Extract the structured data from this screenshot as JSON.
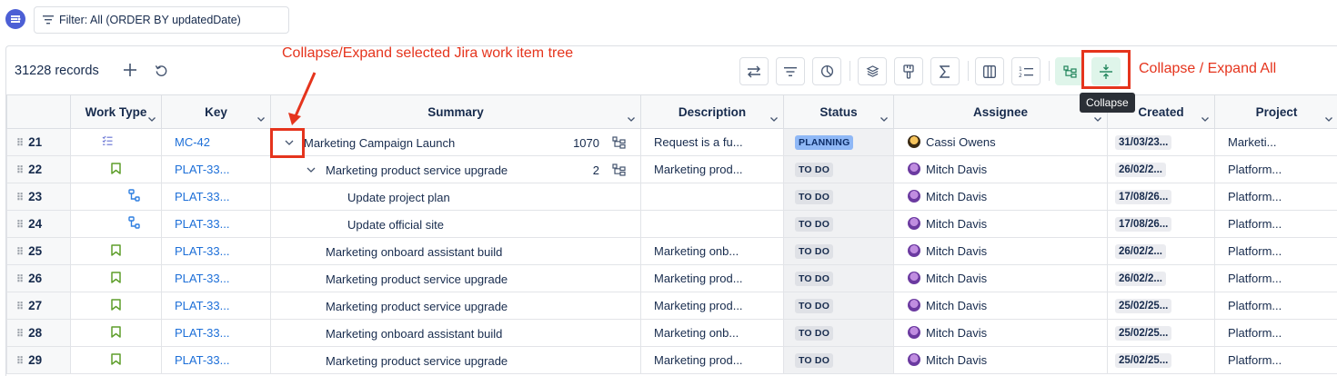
{
  "filter": {
    "label": "Filter: All (ORDER BY updatedDate)"
  },
  "toolbar": {
    "records": "31228 records",
    "tooltip": "Collapse"
  },
  "annotations": {
    "tree_label": "Collapse/Expand selected Jira work item tree",
    "expand_all_label": "Collapse / Expand All"
  },
  "columns": [
    "Work Type",
    "Key",
    "Summary",
    "Description",
    "Status",
    "Assignee",
    "Created",
    "Project"
  ],
  "rows": [
    {
      "num": "21",
      "type": "epic-icon",
      "key": "MC-42",
      "summary": "Marketing Campaign Launch",
      "depth": 0,
      "chevron": true,
      "count": "1070",
      "description": "Request is a fu...",
      "status": "PLANNING",
      "status_kind": "planning",
      "assignee": "Cassi Owens",
      "avatar": "cassi",
      "created": "31/03/23...",
      "project": "Marketi..."
    },
    {
      "num": "22",
      "type": "story-icon",
      "key": "PLAT-33...",
      "summary": "Marketing product service upgrade",
      "depth": 1,
      "chevron": true,
      "count": "2",
      "description": "Marketing prod...",
      "status": "TO DO",
      "status_kind": "todo",
      "assignee": "Mitch Davis",
      "avatar": "mitch",
      "created": "26/02/2...",
      "project": "Platform..."
    },
    {
      "num": "23",
      "type": "subtask-icon",
      "key": "PLAT-33...",
      "summary": "Update project plan",
      "depth": 2,
      "chevron": false,
      "count": "",
      "description": "",
      "status": "TO DO",
      "status_kind": "todo",
      "assignee": "Mitch Davis",
      "avatar": "mitch",
      "created": "17/08/26...",
      "project": "Platform..."
    },
    {
      "num": "24",
      "type": "subtask-icon",
      "key": "PLAT-33...",
      "summary": "Update official site",
      "depth": 2,
      "chevron": false,
      "count": "",
      "description": "",
      "status": "TO DO",
      "status_kind": "todo",
      "assignee": "Mitch Davis",
      "avatar": "mitch",
      "created": "17/08/26...",
      "project": "Platform..."
    },
    {
      "num": "25",
      "type": "story-icon",
      "key": "PLAT-33...",
      "summary": "Marketing onboard assistant build",
      "depth": 1,
      "chevron": false,
      "count": "",
      "description": "Marketing onb...",
      "status": "TO DO",
      "status_kind": "todo",
      "assignee": "Mitch Davis",
      "avatar": "mitch",
      "created": "26/02/2...",
      "project": "Platform..."
    },
    {
      "num": "26",
      "type": "story-icon",
      "key": "PLAT-33...",
      "summary": "Marketing product service upgrade",
      "depth": 1,
      "chevron": false,
      "count": "",
      "description": "Marketing prod...",
      "status": "TO DO",
      "status_kind": "todo",
      "assignee": "Mitch Davis",
      "avatar": "mitch",
      "created": "26/02/2...",
      "project": "Platform..."
    },
    {
      "num": "27",
      "type": "story-icon",
      "key": "PLAT-33...",
      "summary": "Marketing product service upgrade",
      "depth": 1,
      "chevron": false,
      "count": "",
      "description": "Marketing prod...",
      "status": "TO DO",
      "status_kind": "todo",
      "assignee": "Mitch Davis",
      "avatar": "mitch",
      "created": "25/02/25...",
      "project": "Platform..."
    },
    {
      "num": "28",
      "type": "story-icon",
      "key": "PLAT-33...",
      "summary": "Marketing onboard assistant build",
      "depth": 1,
      "chevron": false,
      "count": "",
      "description": "Marketing onb...",
      "status": "TO DO",
      "status_kind": "todo",
      "assignee": "Mitch Davis",
      "avatar": "mitch",
      "created": "25/02/25...",
      "project": "Platform..."
    },
    {
      "num": "29",
      "type": "story-icon",
      "key": "PLAT-33...",
      "summary": "Marketing product service upgrade",
      "depth": 1,
      "chevron": false,
      "count": "",
      "description": "Marketing prod...",
      "status": "TO DO",
      "status_kind": "todo",
      "assignee": "Mitch Davis",
      "avatar": "mitch",
      "created": "25/02/25...",
      "project": "Platform..."
    }
  ],
  "colors": {
    "link": "#1d6fd8",
    "annotation": "#e5341d",
    "planning": "#8fb8f6",
    "story": "#5e9e2b",
    "subtask": "#2f7fe0",
    "active_btn": "#dff5ea"
  }
}
